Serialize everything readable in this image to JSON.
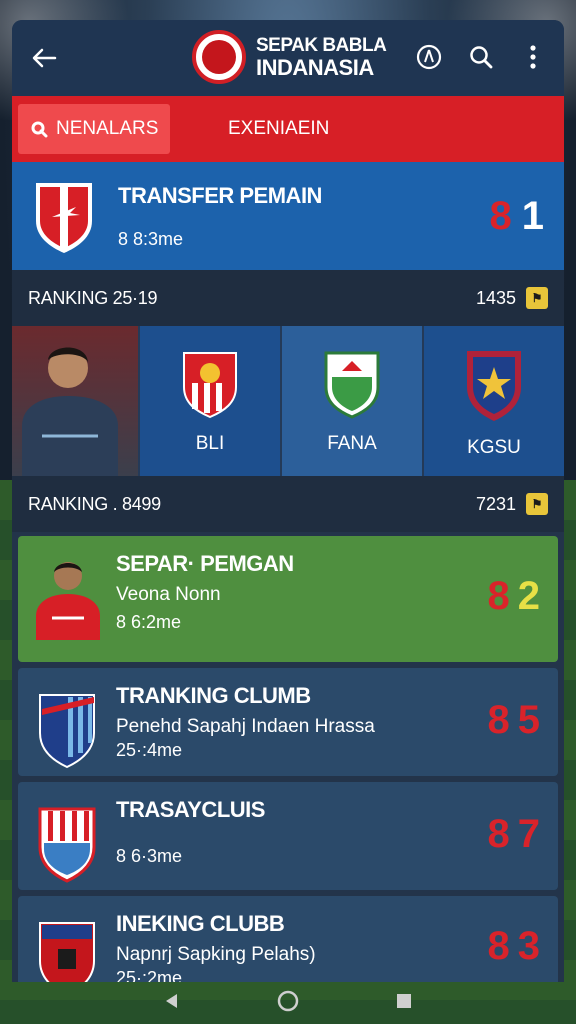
{
  "app": {
    "title_line1": "SEPAK BABLA",
    "title_line2": "INDANASIA"
  },
  "tabs": [
    {
      "label": "NENALARS",
      "active": true
    },
    {
      "label": "EXENIAEIN",
      "active": false
    }
  ],
  "transfer": {
    "title": "TRANSFER PEMAIN",
    "sub": "8 8:3me",
    "score_red": "8",
    "score_white": "1"
  },
  "ranking1": {
    "label": "RANKING  25·19",
    "value": "1435"
  },
  "clubs": [
    {
      "name": "BLI"
    },
    {
      "name": "FANA"
    },
    {
      "name": "KGSU"
    }
  ],
  "ranking2": {
    "label": "RANKING . 8499",
    "value": "7231"
  },
  "cards": [
    {
      "title": "SEPAR· PEMGAN",
      "desc": "Veona Nonn",
      "time": "8 6:2me",
      "score_a": "8",
      "score_b": "2"
    },
    {
      "title": "TRANKING CLUMB",
      "desc": "Penehd Sapahj Indaen Hrassa",
      "time": "25·:4me",
      "score_a": "8",
      "score_b": "5"
    },
    {
      "title": "TRASAYCLUIS",
      "desc": "",
      "time": "8 6·3me",
      "score_a": "8",
      "score_b": "7"
    },
    {
      "title": "INEKING CLUBB",
      "desc": "Napnrj Sapking Pelahs)",
      "time": "25·:2me",
      "score_a": "8",
      "score_b": "3"
    }
  ],
  "colors": {
    "accent_red": "#d71f26",
    "header_blue": "#1f3552",
    "transfer_blue": "#1c62ac",
    "card_green": "#4f8f3f"
  }
}
